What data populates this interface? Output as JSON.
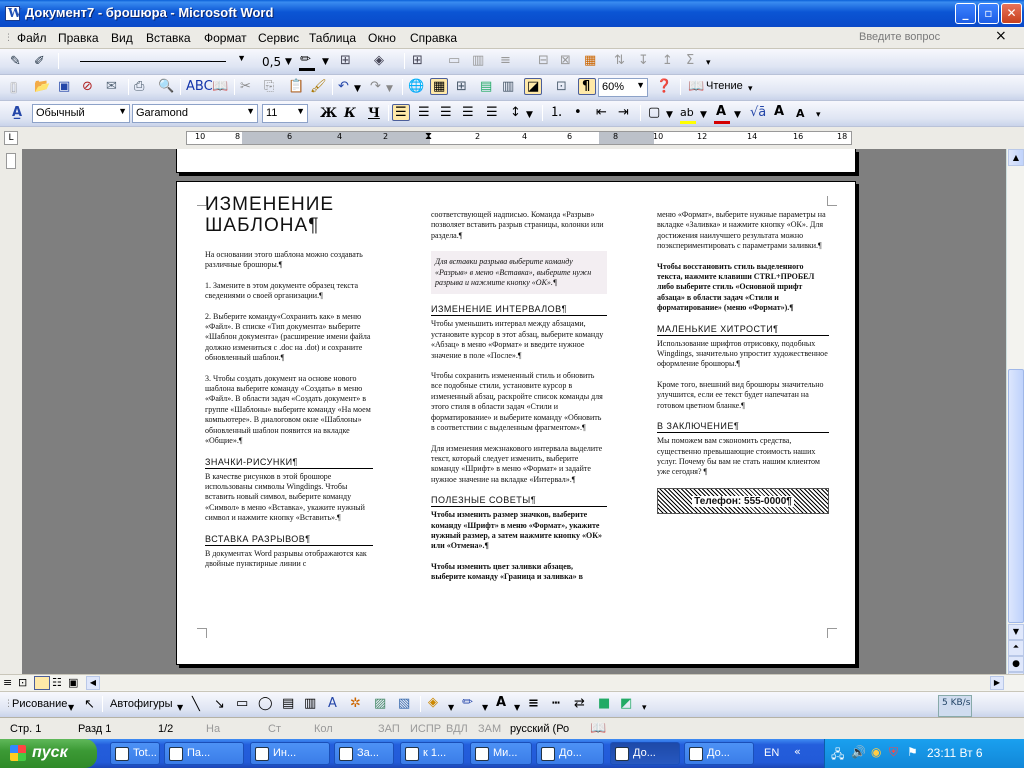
{
  "window": {
    "title": "Документ7 - брошюра - Microsoft Word",
    "min_label": "_",
    "max_label": "▫",
    "close_label": "✕"
  },
  "menu": {
    "items": [
      "Файл",
      "Правка",
      "Вид",
      "Вставка",
      "Формат",
      "Сервис",
      "Таблица",
      "Окно",
      "Справка"
    ],
    "help_placeholder": "Введите вопрос",
    "close_doc": "×"
  },
  "toolbar_tables": {
    "line_weight": "0,5",
    "border_color": "#000000"
  },
  "toolbar_standard": {
    "zoom": "60%",
    "reading_label": "Чтение"
  },
  "toolbar_format": {
    "style": "Обычный",
    "font": "Garamond",
    "size": "11",
    "bold": "Ж",
    "italic": "К",
    "underline": "Ч",
    "font_color": "#d40000",
    "highlight_color": "#ffff00"
  },
  "ruler": {
    "labels": [
      "10",
      "8",
      "6",
      "4",
      "2",
      "2",
      "4",
      "6",
      "8",
      "10",
      "12",
      "14",
      "16",
      "18"
    ]
  },
  "document": {
    "col1": {
      "heading": "ИЗМЕНЕНИЕ ШАБЛОНА¶",
      "intro": "На основании этого шаблона можно создавать различные брошюры.¶",
      "step1": "1. Замените в этом документе образец текста сведениями о своей организации.¶",
      "step2": "2. Выберите команду«Сохранить как» в меню «Файл». В списке «Тип документа» выберите «Шаблон документа» (расширение имени файла должно измениться с .doc на .dot) и сохраните обновленный шаблон.¶",
      "step3": "3. Чтобы создать документ на основе нового шаблона выберите команду «Создать» в меню «Файл». В области задач «Создать документ» в группе «Шаблоны» выберите команду «На моем компьютере». В диалоговом окне «Шаблоны» обновленный шаблон появится на вкладке «Общие».¶",
      "h_symbols": "ЗНАЧКИ-РИСУНКИ¶",
      "symbols_text": "В качестве рисунков в этой брошюре использованы символы Wingdings. Чтобы вставить новый символ, выберите команду «Символ» в меню «Вставка», укажите нужный символ и нажмите кнопку «Вставить».¶",
      "h_breaks": "ВСТАВКА РАЗРЫВОВ¶",
      "breaks_text": "В документах Word разрывы отображаются как двойные пунктирные линии с"
    },
    "col2": {
      "cont": "соответствующей надписью. Команда «Разрыв» позволяет вставить разрыв страницы, колонки или раздела.¶",
      "tip": "Для вставки разрыва выберите команду «Разрыв» в меню «Вставка», выберите нужн разрыва и нажмите кнопку «ОК».¶",
      "h_spacing": "ИЗМЕНЕНИЕ ИНТЕРВАЛОВ¶",
      "spacing1": "Чтобы уменьшить интервал между абзацами, установите курсор в этот абзац, выберите команду «Абзац» в меню «Формат» и введите нужное значение в поле «После».¶",
      "spacing2": "Чтобы сохранить измененный стиль и обновить все подобные стили, установите курсор в измененный абзац, раскройте список команды для этого стиля в области задач «Стили и форматирование» и выберите команду «Обновить в соответствии с выделенным фрагментом».¶",
      "spacing3": "Для изменения межзнакового интервала выделите текст, который следует изменить, выберите команду «Шрифт» в меню «Формат» и задайте нужное значение на вкладке «Интервал».¶",
      "h_tips": "ПОЛЕЗНЫЕ СОВЕТЫ¶",
      "tips1": "Чтобы изменить размер значков, выберите команду «Шрифт» в меню «Формат», укажите нужный размер, а затем нажмите кнопку «ОК» или «Отмена».¶",
      "tips2": "Чтобы изменить цвет заливки абзацев, выберите команду «Граница и заливка» в"
    },
    "col3": {
      "cont": "меню «Формат», выберите нужные параметры на вкладке «Заливка» и нажмите кнопку «ОК». Для достижения наилучшего результата можно поэкспериментировать с параметрами заливки.¶",
      "bold_tip": "Чтобы восстановить стиль выделенного текста, нажмите клавиши CTRL+ПРОБЕЛ либо выберите стиль «Основной шрифт абзаца» в области задач «Стили и форматирование» (меню «Формат»).¶",
      "h_tricks": "МАЛЕНЬКИЕ ХИТРОСТИ¶",
      "tricks1": "Использование шрифтов отрисовку, подобных Wingdings, значительно упростит художественное оформление брошюры.¶",
      "tricks2": "Кроме того, внешний вид брошюры значительно улучшится, если ее текст будет напечатан на готовом цветном бланке.¶",
      "h_conclusion": "В ЗАКЛЮЧЕНИЕ¶",
      "conclusion": "Мы поможем вам сэкономить средства, существенно превышающие стоимость наших услуг. Почему бы вам не стать нашим клиентом уже сегодня? ¶",
      "phone": "Телефон: 555-0000¶"
    }
  },
  "drawing_toolbar": {
    "draw_label": "Рисование",
    "autoshapes_label": "Автофигуры"
  },
  "status": {
    "page": "Стр. 1",
    "section": "Разд 1",
    "pages": "1/2",
    "at": "На",
    "line": "Ст",
    "col": "Кол",
    "rec": "ЗАП",
    "trk": "ИСПР",
    "ext": "ВДЛ",
    "ovr": "ЗАМ",
    "lang": "русский (Ро",
    "net_speed": "5 KB/s"
  },
  "taskbar": {
    "start_label": "пуск",
    "tasks": [
      "Tot...",
      "Па...",
      "Ин...",
      "За...",
      "к 1...",
      "Ми...",
      "До...",
      "До...",
      "До..."
    ],
    "lang": "EN",
    "clock": "23:11 Вт 6"
  }
}
